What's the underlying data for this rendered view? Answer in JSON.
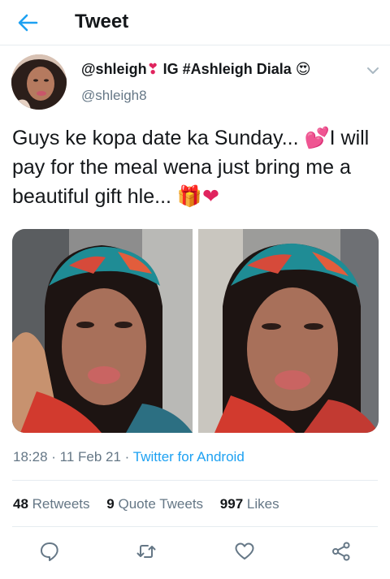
{
  "header": {
    "title": "Tweet",
    "back_icon": "back-arrow-icon"
  },
  "tweet": {
    "author": {
      "display_name": "@shleigh",
      "display_name_emoji_1": "❣",
      "display_name_middle": "IG #Ashleigh Diala",
      "display_name_emoji_2": "😍",
      "handle": "@shleigh8"
    },
    "text_part_1": "Guys ke kopa date ka Sunday... ",
    "text_emoji_1": "💕",
    "text_part_2": "I will pay for the meal wena just bring me a beautiful gift hle... ",
    "text_emoji_2": "🎁",
    "text_emoji_3": "❤",
    "media_count": 2,
    "time": "18:28",
    "sep_1": " · ",
    "date": "11 Feb 21",
    "sep_2": " · ",
    "source": "Twitter for Android"
  },
  "stats": {
    "retweets_count": "48",
    "retweets_label": "Retweets",
    "quote_tweets_count": "9",
    "quote_tweets_label": "Quote Tweets",
    "likes_count": "997",
    "likes_label": "Likes"
  },
  "actions": [
    "reply-icon",
    "retweet-icon",
    "like-icon",
    "share-icon"
  ],
  "colors": {
    "accent": "#1da1f2",
    "text": "#14171a",
    "muted": "#657786",
    "divider": "#e6ecf0"
  }
}
